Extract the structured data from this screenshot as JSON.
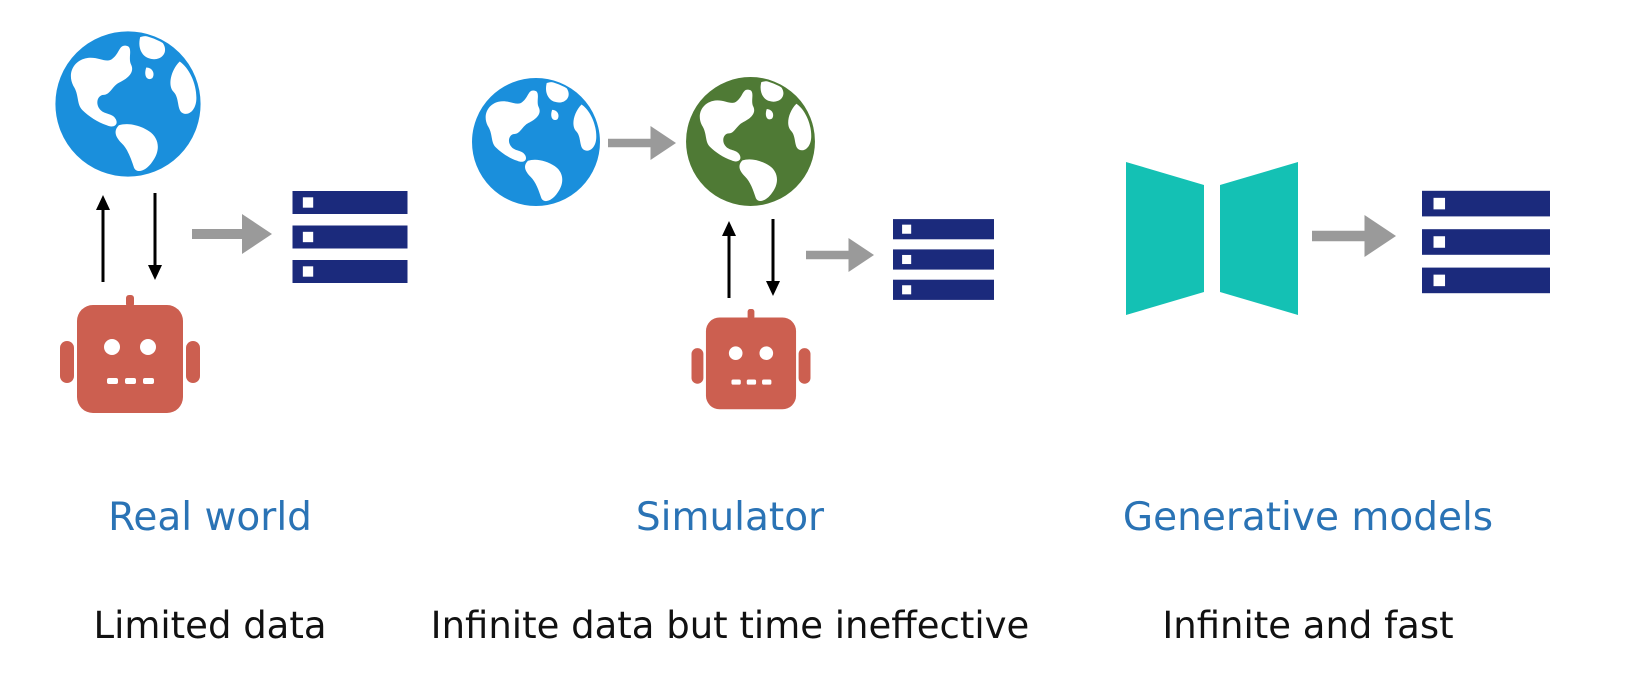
{
  "panels": {
    "real_world": {
      "title": "Real world",
      "caption": "Limited data"
    },
    "simulator": {
      "title": "Simulator",
      "caption": "Infinite data but time ineffective"
    },
    "generative": {
      "title": "Generative models",
      "caption": "Infinite and fast"
    }
  },
  "icons": {
    "globe_real": "globe-icon",
    "globe_sim": "globe-icon",
    "robot": "robot-icon",
    "data_stack": "data-stack-icon",
    "generative_model": "encoder-decoder-icon",
    "arrow": "arrow-right-icon"
  },
  "colors": {
    "title": "#2a73b5",
    "caption": "#111111",
    "globe_blue": "#1a8fdc",
    "globe_green": "#4f7a35",
    "land": "#ffffff",
    "robot": "#cc5f50",
    "data_stack": "#1b2a7c",
    "model": "#14c1b4",
    "arrow_gray": "#9a9a9a"
  }
}
